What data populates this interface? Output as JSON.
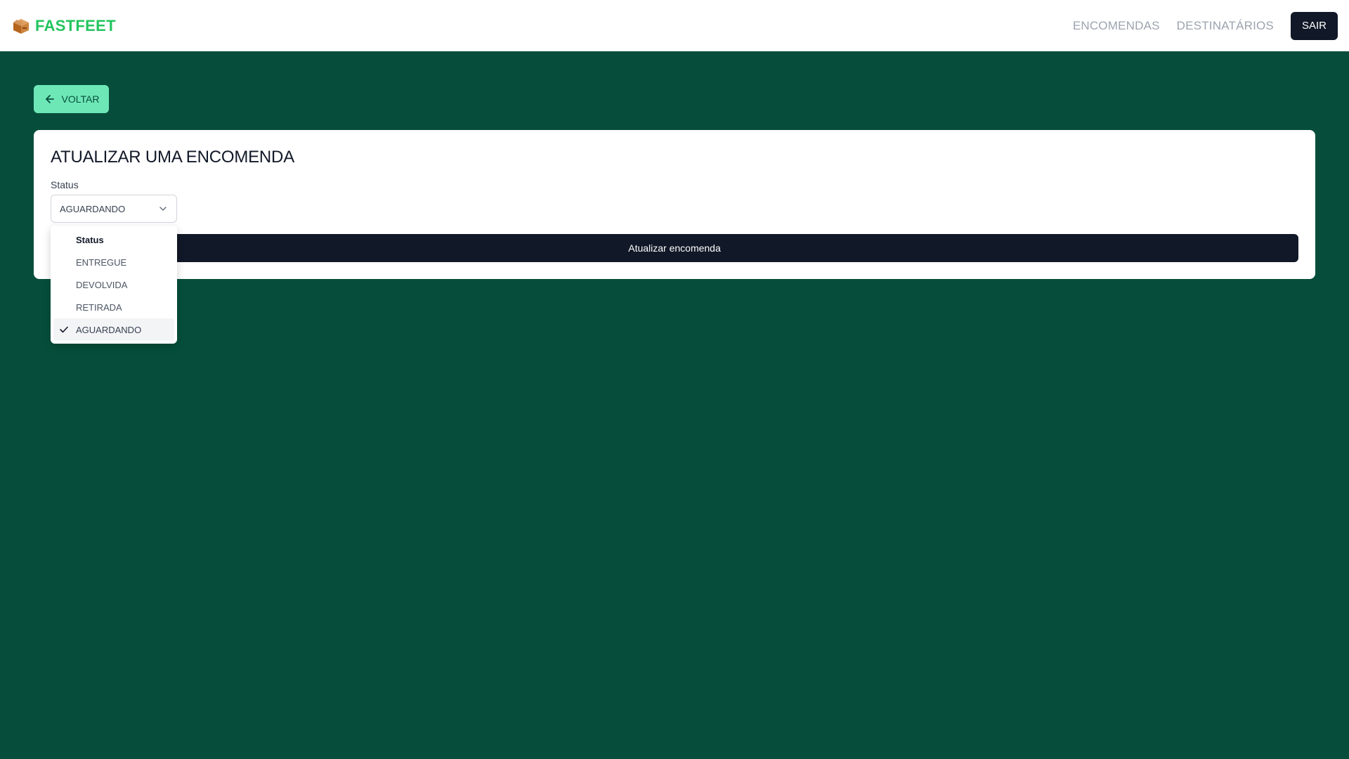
{
  "header": {
    "logo_text": "FASTFEET",
    "logo_icon": "box-icon",
    "nav": [
      {
        "label": "ENCOMENDAS"
      },
      {
        "label": "DESTINATÁRIOS"
      }
    ],
    "logout_label": "SAIR"
  },
  "back_button": {
    "label": "VOLTAR",
    "icon": "arrow-left-icon"
  },
  "form": {
    "title": "ATUALIZAR UMA ENCOMENDA",
    "status_label": "Status",
    "status_value": "AGUARDANDO",
    "submit_label": "Atualizar encomenda"
  },
  "dropdown": {
    "group_label": "Status",
    "options": [
      {
        "label": "ENTREGUE",
        "selected": false
      },
      {
        "label": "DEVOLVIDA",
        "selected": false
      },
      {
        "label": "RETIRADA",
        "selected": false
      },
      {
        "label": "AGUARDANDO",
        "selected": true
      }
    ]
  },
  "colors": {
    "background": "#064e3b",
    "brand": "#22c55e",
    "back_button": "#6ee7b7",
    "dark": "#111827"
  }
}
